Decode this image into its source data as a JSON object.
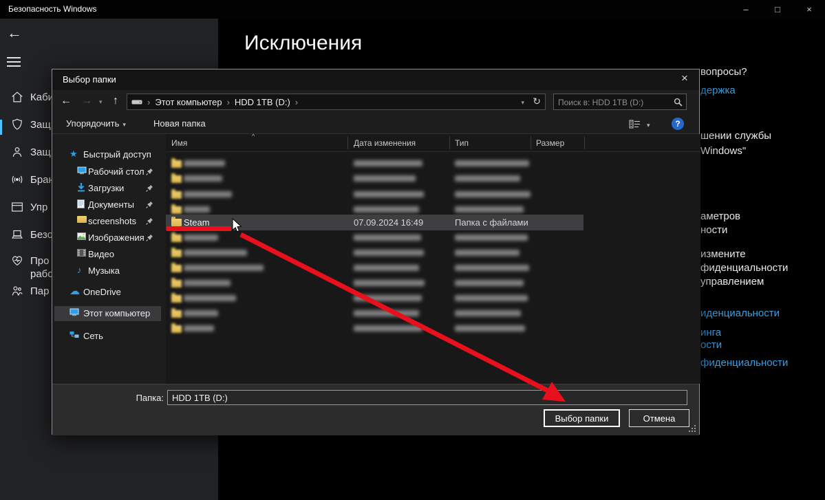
{
  "glyphs": {
    "back": "←",
    "forward": "→",
    "up": "↑",
    "refresh": "↻",
    "chevron": "›",
    "caret": "▾",
    "sort": "^",
    "minimize": "–",
    "maximize": "□",
    "close": "×",
    "help": "?",
    "star": "★",
    "note": "♪",
    "cloud": "☁"
  },
  "window": {
    "title": "Безопасность Windows"
  },
  "app": {
    "page_title": "Исключения",
    "nav": [
      {
        "label": "Каби"
      },
      {
        "label": "Защ"
      },
      {
        "label": "Защ"
      },
      {
        "label": "Бран"
      },
      {
        "label": "Упр"
      },
      {
        "label": "Безо"
      },
      {
        "label": "Про",
        "label2": "рабо"
      },
      {
        "label": "Пар"
      }
    ],
    "right_lines": [
      {
        "text": "вопросы?"
      },
      {
        "text": "держка"
      },
      {
        "text": "шении службы"
      },
      {
        "text": "Windows\""
      },
      {
        "text": "аметров"
      },
      {
        "text": "ности"
      },
      {
        "text": "измените"
      },
      {
        "text": "фиденциальности"
      },
      {
        "text": "управлением"
      },
      {
        "text": "иденциальности"
      },
      {
        "text": "инга"
      },
      {
        "text": "ости"
      },
      {
        "text": "фиденциальности"
      }
    ]
  },
  "dialog": {
    "title": "Выбор папки",
    "breadcrumb": {
      "root": "Этот компьютер",
      "drive": "HDD 1TB (D:)"
    },
    "search_placeholder": "Поиск в: HDD 1TB (D:)",
    "toolbar": {
      "organize": "Упорядочить",
      "new_folder": "Новая папка"
    },
    "columns": {
      "name": "Имя",
      "date": "Дата изменения",
      "type": "Тип",
      "size": "Размер"
    },
    "sidebar": [
      {
        "label": "Быстрый доступ"
      },
      {
        "label": "Рабочий стол"
      },
      {
        "label": "Загрузки"
      },
      {
        "label": "Документы"
      },
      {
        "label": "screenshots"
      },
      {
        "label": "Изображения"
      },
      {
        "label": "Видео"
      },
      {
        "label": "Музыка"
      },
      {
        "label": "OneDrive"
      },
      {
        "label": "Этот компьютер"
      },
      {
        "label": "Сеть"
      }
    ],
    "selected_row": {
      "name": "Steam",
      "date": "07.09.2024 16:49",
      "type": "Папка с файлами"
    },
    "redacted_rows": {
      "above": 4,
      "below": 7
    },
    "footer": {
      "label": "Папка:",
      "value": "HDD 1TB (D:)",
      "choose_button": "Выбор папки",
      "cancel_button": "Отмена"
    }
  },
  "annotation": {
    "arrow_color": "#e8101c"
  }
}
